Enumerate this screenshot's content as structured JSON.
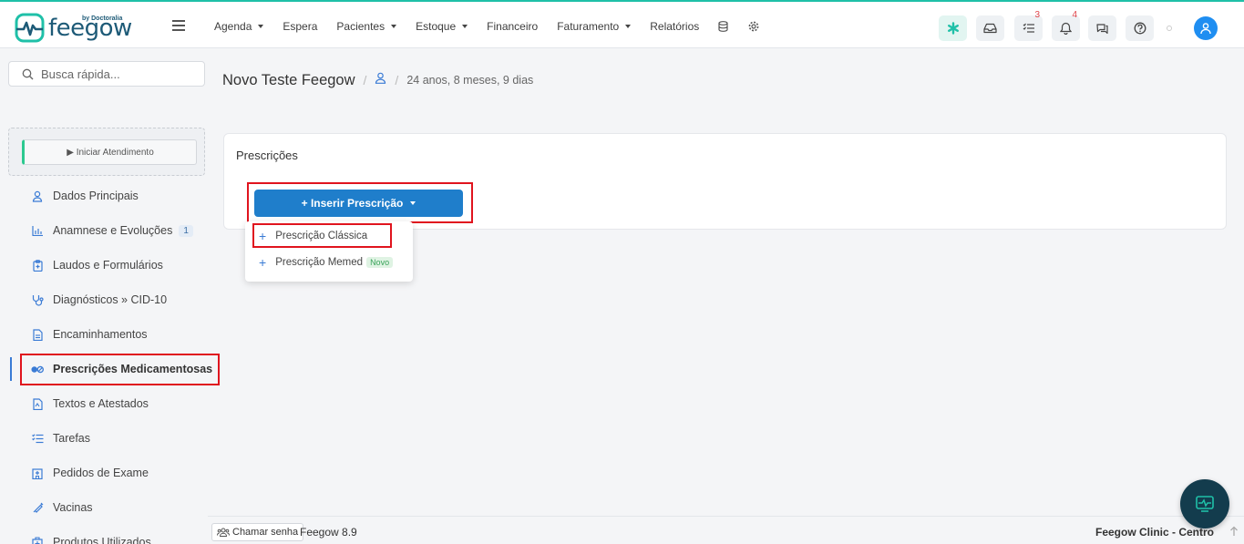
{
  "brand": {
    "name": "feegow",
    "by": "by Doctoralia"
  },
  "nav": {
    "items": [
      {
        "label": "Agenda",
        "dropdown": true
      },
      {
        "label": "Espera",
        "dropdown": false
      },
      {
        "label": "Pacientes",
        "dropdown": true
      },
      {
        "label": "Estoque",
        "dropdown": true
      },
      {
        "label": "Financeiro",
        "dropdown": false
      },
      {
        "label": "Faturamento",
        "dropdown": true
      },
      {
        "label": "Relatórios",
        "dropdown": false
      }
    ]
  },
  "toolbar": {
    "tasks_count": "3",
    "notifications_count": "4"
  },
  "search": {
    "placeholder": "Busca rápida..."
  },
  "sidebar": {
    "start_button": "▶ Iniciar Atendimento",
    "items": [
      {
        "label": "Dados Principais",
        "icon": "user-icon"
      },
      {
        "label": "Anamnese e Evoluções",
        "icon": "chart-icon",
        "badge": "1"
      },
      {
        "label": "Laudos e Formulários",
        "icon": "clipboard-icon"
      },
      {
        "label": "Diagnósticos » CID-10",
        "icon": "stethoscope-icon"
      },
      {
        "label": "Encaminhamentos",
        "icon": "document-icon"
      },
      {
        "label": "Prescrições Medicamentosas",
        "icon": "pills-icon",
        "active": true
      },
      {
        "label": "Textos e Atestados",
        "icon": "file-text-icon"
      },
      {
        "label": "Tarefas",
        "icon": "tasks-icon"
      },
      {
        "label": "Pedidos de Exame",
        "icon": "hospital-icon"
      },
      {
        "label": "Vacinas",
        "icon": "syringe-icon"
      },
      {
        "label": "Produtos Utilizados",
        "icon": "box-icon"
      }
    ]
  },
  "page": {
    "title": "Novo Teste Feegow",
    "age": "24 anos, 8 meses, 9 dias"
  },
  "panel": {
    "title": "Prescrições",
    "insert_button": "+ Inserir Prescrição"
  },
  "dropdown": {
    "classic": "Prescrição Clássica",
    "memed": "Prescrição Memed",
    "new_badge": "Novo"
  },
  "footer": {
    "call_button": "Chamar senha",
    "version": "Feegow 8.9",
    "clinic": "Feegow Clinic - Centro"
  },
  "colors": {
    "accent": "#1f7ecb",
    "brand": "#1d5a77",
    "highlight": "#e0141e",
    "teal": "#1fc0a8"
  }
}
